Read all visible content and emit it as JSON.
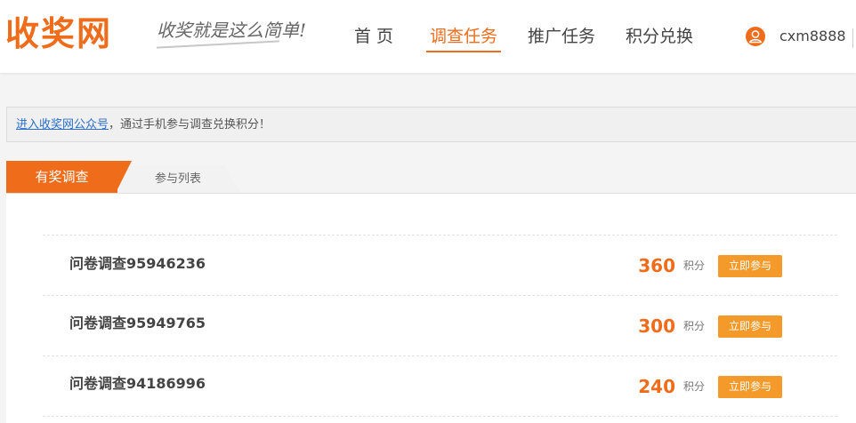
{
  "header": {
    "logo": "收奖网",
    "slogan": "收奖就是这么简单!",
    "nav": [
      {
        "label": "首 页",
        "active": false
      },
      {
        "label": "调查任务",
        "active": true
      },
      {
        "label": "推广任务",
        "active": false
      },
      {
        "label": "积分兑换",
        "active": false
      }
    ],
    "user": {
      "icon": "user-icon",
      "name": "cxm8888"
    }
  },
  "notice": {
    "link": "进入收奖网公众号",
    "text": "，通过手机参与调查兑换积分！"
  },
  "tabs": [
    {
      "label": "有奖调查",
      "active": true
    },
    {
      "label": "参与列表",
      "active": false
    }
  ],
  "surveys": [
    {
      "title": "问卷调查95946236",
      "points": "360",
      "unit": "积分",
      "action": "立即参与"
    },
    {
      "title": "问卷调查95949765",
      "points": "300",
      "unit": "积分",
      "action": "立即参与"
    },
    {
      "title": "问卷调查94186996",
      "points": "240",
      "unit": "积分",
      "action": "立即参与"
    }
  ],
  "colors": {
    "accent": "#ef6c1b",
    "button": "#f39a2a",
    "link": "#2a6fc9"
  }
}
